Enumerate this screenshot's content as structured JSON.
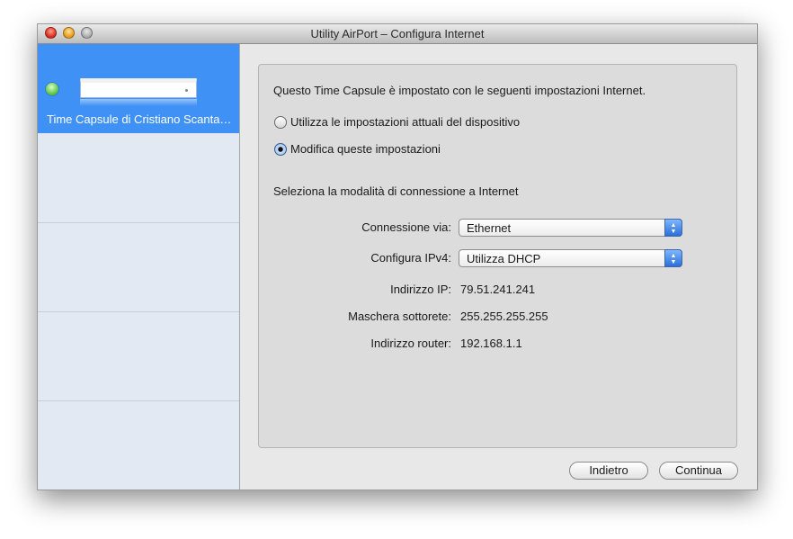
{
  "window": {
    "title": "Utility AirPort – Configura Internet"
  },
  "sidebar": {
    "device": {
      "name": "Time Capsule di Cristiano Scanta…",
      "status_color": "#62c94a"
    }
  },
  "main": {
    "intro": "Questo Time Capsule è impostato con le seguenti impostazioni Internet.",
    "radio_options": [
      {
        "label": "Utilizza le impostazioni attuali del dispositivo",
        "checked": false
      },
      {
        "label": "Modifica queste impostazioni",
        "checked": true
      }
    ],
    "section_heading": "Seleziona la modalità di connessione a Internet",
    "fields": {
      "connection_label": "Connessione via:",
      "connection_value": "Ethernet",
      "ipv4_label": "Configura IPv4:",
      "ipv4_value": "Utilizza DHCP",
      "ip_label": "Indirizzo IP:",
      "ip_value": "79.51.241.241",
      "subnet_label": "Maschera sottorete:",
      "subnet_value": "255.255.255.255",
      "router_label": "Indirizzo router:",
      "router_value": "192.168.1.1"
    }
  },
  "footer": {
    "back_label": "Indietro",
    "continue_label": "Continua"
  },
  "colors": {
    "selection": "#3f91f5",
    "popup_accent": "#2b6fd8"
  }
}
